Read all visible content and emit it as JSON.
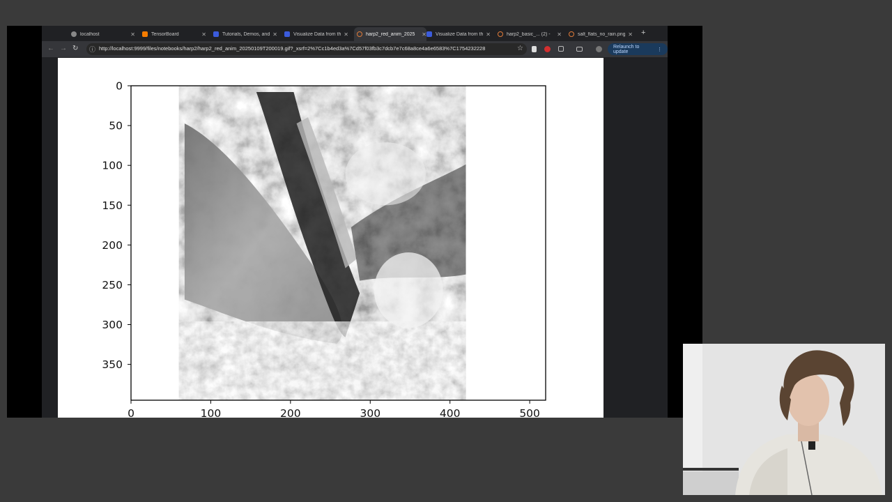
{
  "browser": {
    "tabs": [
      {
        "title": "localhost",
        "active": false
      },
      {
        "title": "TensorBoard",
        "active": false
      },
      {
        "title": "Tutorials, Demos, and",
        "active": false
      },
      {
        "title": "Visualize Data from th",
        "active": false
      },
      {
        "title": "harp2_red_anim_2025",
        "active": true
      },
      {
        "title": "Visualize Data from th",
        "active": false
      },
      {
        "title": "harp2_basic_... (2) -",
        "active": false
      },
      {
        "title": "salt_flats_no_rain.png",
        "active": false
      }
    ],
    "url": "http://localhost:9999/files/notebooks/harp2/harp2_red_anim_20250109T200019.gif?_xsrf=2%7Cc1b4ed3a%7Cd57f03fb3c7dcb7e7c68a8ce4a6e6583%7C1754232228",
    "relaunch_label": "Relaunch to update",
    "more_glyph": "⋮",
    "new_tab_glyph": "+"
  },
  "chart_data": {
    "type": "image",
    "title": "",
    "xlabel": "",
    "ylabel": "",
    "xlim": [
      0,
      520
    ],
    "ylim": [
      395,
      0
    ],
    "x_ticks": [
      0,
      100,
      200,
      300,
      400,
      500
    ],
    "y_ticks": [
      0,
      50,
      100,
      150,
      200,
      250,
      300,
      350
    ],
    "image_extent_x": [
      60,
      420
    ],
    "image_extent_y": [
      0,
      395
    ],
    "grid": false
  },
  "colors": {
    "desktop": "#3a3a3a",
    "browser_chrome": "#202124",
    "toolbar": "#35363a",
    "plot_background": "#ffffff"
  }
}
